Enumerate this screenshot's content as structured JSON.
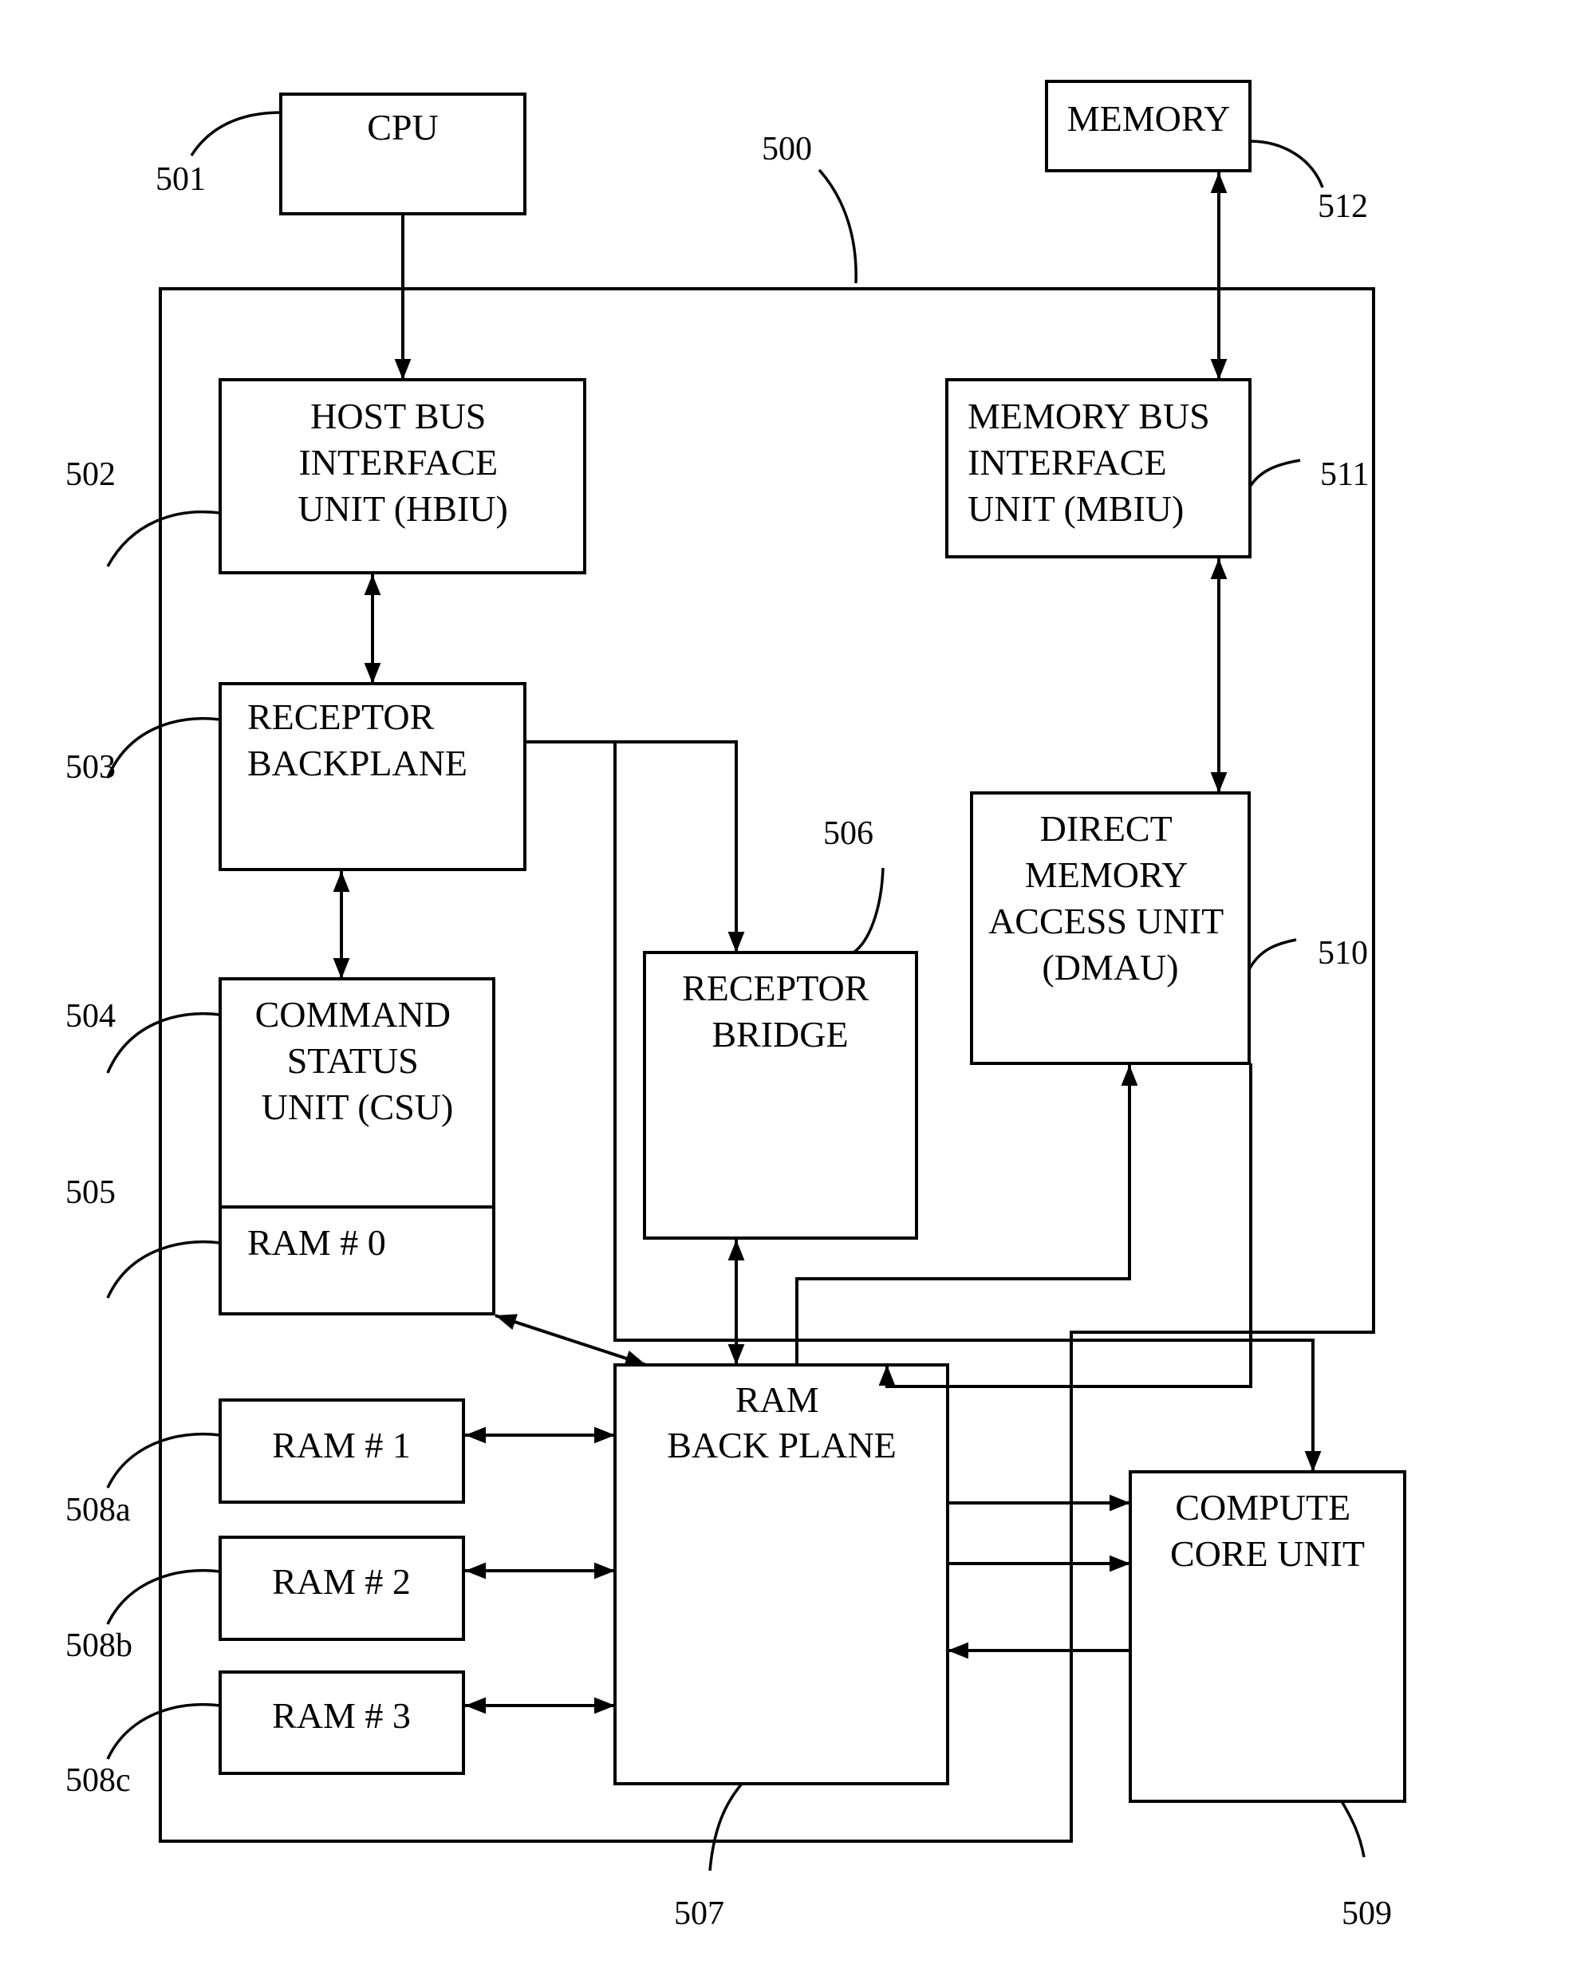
{
  "diagram": {
    "system_ref": "500",
    "blocks": {
      "cpu": {
        "ref": "501",
        "lines": [
          "CPU"
        ]
      },
      "hbiu": {
        "ref": "502",
        "lines": [
          "HOST BUS",
          "INTERFACE",
          "UNIT (HBIU)"
        ]
      },
      "receptor_backplane": {
        "ref": "503",
        "lines": [
          "RECEPTOR",
          "BACKPLANE"
        ]
      },
      "csu": {
        "ref": "504",
        "lines": [
          "COMMAND",
          "STATUS",
          "UNIT (CSU)"
        ]
      },
      "ram0": {
        "ref": "505",
        "lines": [
          "RAM # 0"
        ]
      },
      "receptor_bridge": {
        "ref": "506",
        "lines": [
          "RECEPTOR",
          "BRIDGE"
        ]
      },
      "ram_backplane": {
        "ref": "507",
        "lines": [
          "RAM",
          "BACK PLANE"
        ]
      },
      "ram1": {
        "ref": "508a",
        "lines": [
          "RAM # 1"
        ]
      },
      "ram2": {
        "ref": "508b",
        "lines": [
          "RAM # 2"
        ]
      },
      "ram3": {
        "ref": "508c",
        "lines": [
          "RAM # 3"
        ]
      },
      "compute_core": {
        "ref": "509",
        "lines": [
          "COMPUTE",
          "CORE UNIT"
        ]
      },
      "dmau": {
        "ref": "510",
        "lines": [
          "DIRECT",
          "MEMORY",
          "ACCESS UNIT",
          "(DMAU)"
        ]
      },
      "mbiu": {
        "ref": "511",
        "lines": [
          "MEMORY BUS",
          "INTERFACE",
          "UNIT (MBIU)"
        ]
      },
      "memory": {
        "ref": "512",
        "lines": [
          "MEMORY"
        ]
      }
    },
    "connections": [
      {
        "from": "cpu",
        "to": "hbiu",
        "direction": "one-way"
      },
      {
        "from": "hbiu",
        "to": "receptor_backplane",
        "direction": "two-way"
      },
      {
        "from": "receptor_backplane",
        "to": "csu",
        "direction": "two-way"
      },
      {
        "from": "receptor_backplane",
        "to": "receptor_bridge",
        "direction": "one-way"
      },
      {
        "from": "receptor_backplane",
        "to": "compute_core",
        "direction": "one-way"
      },
      {
        "from": "csu",
        "to": "ram_backplane",
        "direction": "two-way"
      },
      {
        "from": "receptor_bridge",
        "to": "ram_backplane",
        "direction": "two-way"
      },
      {
        "from": "ram_backplane",
        "to": "dmau",
        "direction": "one-way"
      },
      {
        "from": "dmau",
        "to": "ram_backplane",
        "direction": "one-way"
      },
      {
        "from": "memory",
        "to": "mbiu",
        "direction": "two-way"
      },
      {
        "from": "mbiu",
        "to": "dmau",
        "direction": "two-way"
      },
      {
        "from": "ram1",
        "to": "ram_backplane",
        "direction": "two-way"
      },
      {
        "from": "ram2",
        "to": "ram_backplane",
        "direction": "two-way"
      },
      {
        "from": "ram3",
        "to": "ram_backplane",
        "direction": "two-way"
      },
      {
        "from": "ram_backplane",
        "to": "compute_core",
        "direction": "one-way"
      },
      {
        "from": "ram_backplane",
        "to": "compute_core",
        "direction": "one-way"
      },
      {
        "from": "compute_core",
        "to": "ram_backplane",
        "direction": "one-way"
      }
    ]
  }
}
